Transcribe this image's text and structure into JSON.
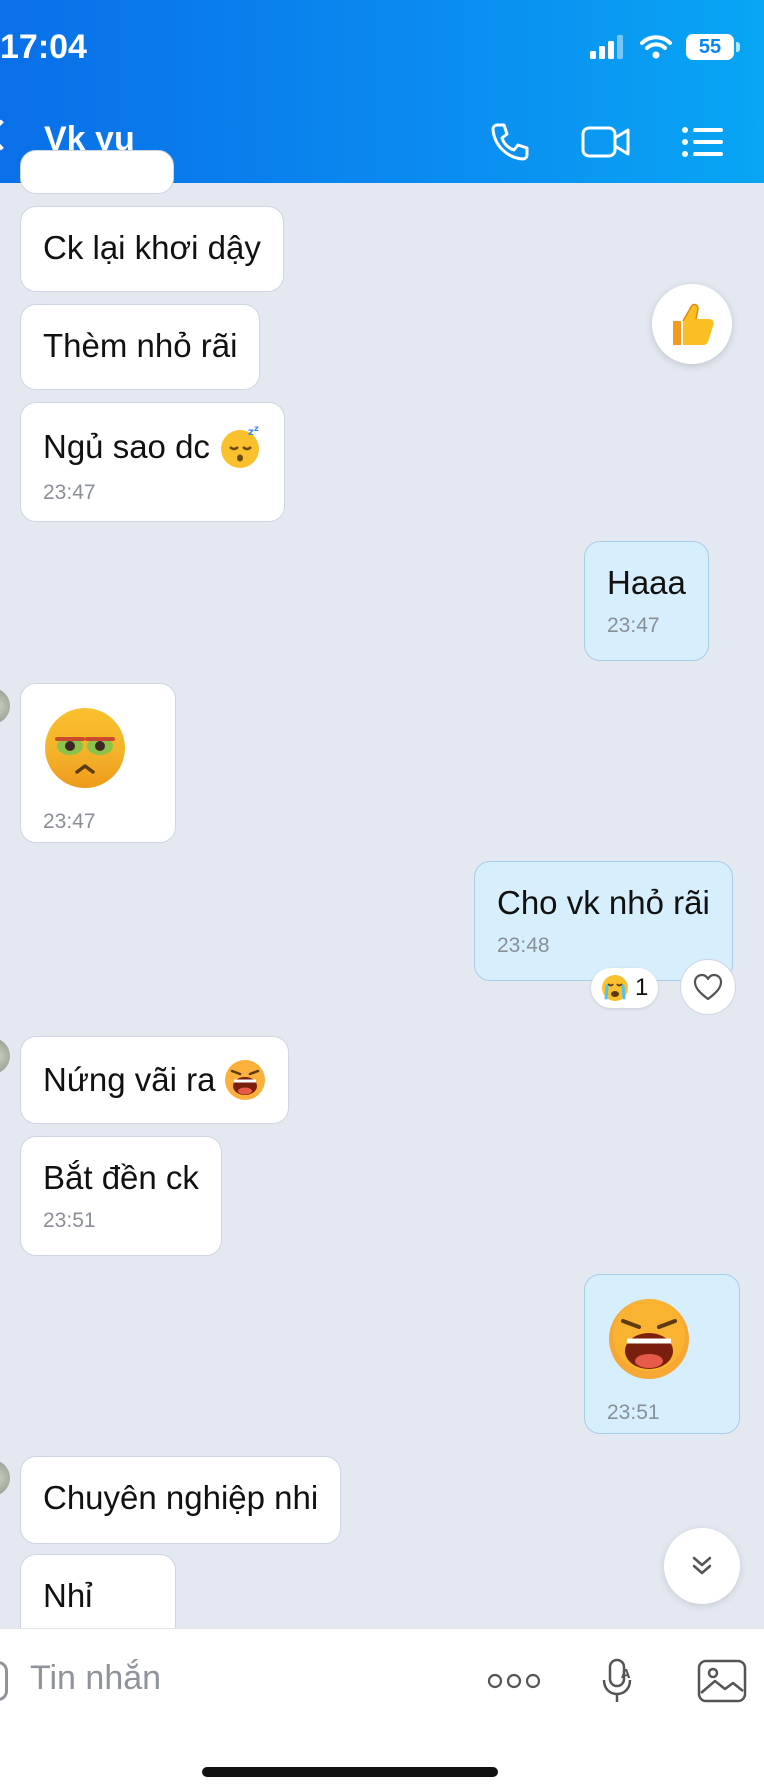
{
  "status_bar": {
    "time": "17:04",
    "battery": "55"
  },
  "header": {
    "title": "Vk yu"
  },
  "icons": {
    "back": "chevron-left-icon",
    "call": "phone-icon",
    "video": "video-camera-icon",
    "menu": "list-icon",
    "like": "thumbs-up-icon",
    "heart": "heart-icon",
    "scroll": "double-chevron-down-icon",
    "more": "more-dots-icon",
    "mic": "microphone-icon",
    "image": "image-icon"
  },
  "colors": {
    "header_start": "#0a6fe8",
    "header_end": "#08a6f4",
    "bubble_me": "#d7eefd",
    "background": "#e3e8f1"
  },
  "messages": [
    {
      "text": "Ck lại khơi dậy"
    },
    {
      "text": "Thèm nhỏ rãi"
    },
    {
      "text": "Ngủ sao dc",
      "emoji": "sleeping-face",
      "time": "23:47"
    },
    {
      "text": "Haaa",
      "time": "23:47"
    },
    {
      "emoji": "nauseated-face",
      "time": "23:47"
    },
    {
      "text": "Cho vk nhỏ rãi",
      "time": "23:48"
    },
    {
      "text": "Nứng vãi ra",
      "emoji": "laughing-face"
    },
    {
      "text": "Bắt đền ck",
      "time": "23:51"
    },
    {
      "emoji": "laughing-face",
      "time": "23:51"
    },
    {
      "text": "Chuyên nghiệp nhi"
    },
    {
      "text": "Nhỉ"
    }
  ],
  "reaction": {
    "emoji": "crying-face",
    "count": "1"
  },
  "composer": {
    "placeholder": "Tin nhắn"
  }
}
